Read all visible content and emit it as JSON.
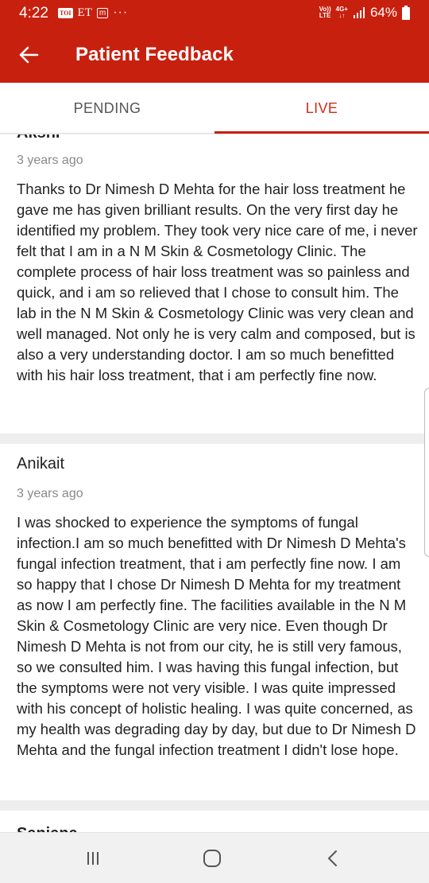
{
  "status_bar": {
    "time": "4:22",
    "notifications": [
      "TOI",
      "ET",
      "m"
    ],
    "more": "···",
    "volte_top": "Vo))",
    "volte_bottom": "LTE",
    "network_top": "4G+",
    "network_bottom": "↓↑",
    "battery": "64%",
    "icons": [
      "signal-icon",
      "battery-icon"
    ]
  },
  "app_bar": {
    "title": "Patient Feedback",
    "back_icon": "arrow-left-icon"
  },
  "tabs": [
    {
      "label": "PENDING",
      "selected": false
    },
    {
      "label": "LIVE",
      "selected": true
    }
  ],
  "colors": {
    "primary": "#c8200e",
    "tab_active": "#d42a1a",
    "background": "#eeeeee"
  },
  "reviews": [
    {
      "name": "Akshi",
      "time": "3 years ago",
      "text": "Thanks to Dr Nimesh D Mehta for the hair loss treatment he gave me has given brilliant results. On the very first day he identified my problem. They took very nice care of me, i never felt that I am in a N M Skin & Cosmetology Clinic. The complete process of hair loss treatment was so painless and quick, and i am so relieved that I chose to consult him. The lab in the N M Skin & Cosmetology Clinic was very clean and well managed. Not only he is very calm and composed, but is also a very understanding doctor. I am so much benefitted with his hair loss treatment, that i am perfectly fine now."
    },
    {
      "name": "Anikait",
      "time": "3 years ago",
      "text": "I was shocked to experience the symptoms of fungal infection.I am so much benefitted with Dr Nimesh D Mehta's fungal infection treatment, that i am perfectly fine now. I am so happy that I chose Dr Nimesh D Mehta for my treatment as now I am perfectly fine. The facilities available in the N M Skin & Cosmetology Clinic are very nice. Even though Dr Nimesh D Mehta is not from our city, he is still very famous, so we consulted him. I was having this fungal infection, but the symptoms were not very visible. I was quite impressed with his concept of holistic healing. I was quite concerned, as my health was degrading day by day, but due to Dr Nimesh D Mehta and the fungal infection treatment I didn't lose hope."
    },
    {
      "name": "Sanjana"
    }
  ],
  "nav_bar": {
    "buttons": [
      "recents-icon",
      "home-icon",
      "back-icon"
    ]
  }
}
